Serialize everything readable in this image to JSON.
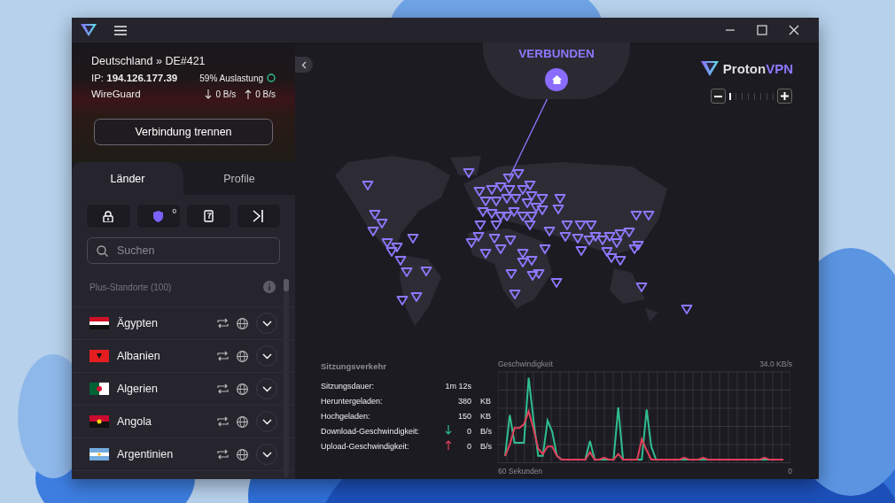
{
  "connection": {
    "server": "Deutschland » DE#421",
    "ip_label": "IP:",
    "ip": "194.126.177.39",
    "load": "59% Auslastung",
    "protocol": "WireGuard",
    "download": "0 B/s",
    "upload": "0 B/s"
  },
  "disconnect_button": "Verbindung trennen",
  "tabs": [
    {
      "label": "Länder",
      "selected": true
    },
    {
      "label": "Profile",
      "selected": false
    }
  ],
  "netshield_badge": "0",
  "search": {
    "placeholder": "Suchen"
  },
  "section_title": "Plus-Standorte (100)",
  "countries": [
    {
      "name": "Ägypten",
      "kind": "eg"
    },
    {
      "name": "Albanien",
      "kind": "al"
    },
    {
      "name": "Algerien",
      "kind": "dz"
    },
    {
      "name": "Angola",
      "kind": "ao"
    },
    {
      "name": "Argentinien",
      "kind": "ar"
    }
  ],
  "status": "VERBUNDEN",
  "brand": {
    "first": "Proton",
    "second": "VPN"
  },
  "zoom": {
    "level": 0
  },
  "session": {
    "title": "Sitzungsverkehr",
    "rows": [
      {
        "label": "Sitzungsdauer:",
        "value": "1m 12s"
      },
      {
        "label": "Heruntergeladen:",
        "value": "380",
        "unit": "KB"
      },
      {
        "label": "Hochgeladen:",
        "value": "150",
        "unit": "KB"
      },
      {
        "label": "Download-Geschwindigkeit:",
        "kind": "down",
        "value": "0",
        "unit": "B/s"
      },
      {
        "label": "Upload-Geschwindigkeit:",
        "kind": "up",
        "value": "0",
        "unit": "B/s"
      }
    ]
  },
  "speed": {
    "title": "Geschwindigkeit",
    "max": "34.0  KB/s",
    "x_start": "60 Sekunden",
    "x_end": "0"
  }
}
